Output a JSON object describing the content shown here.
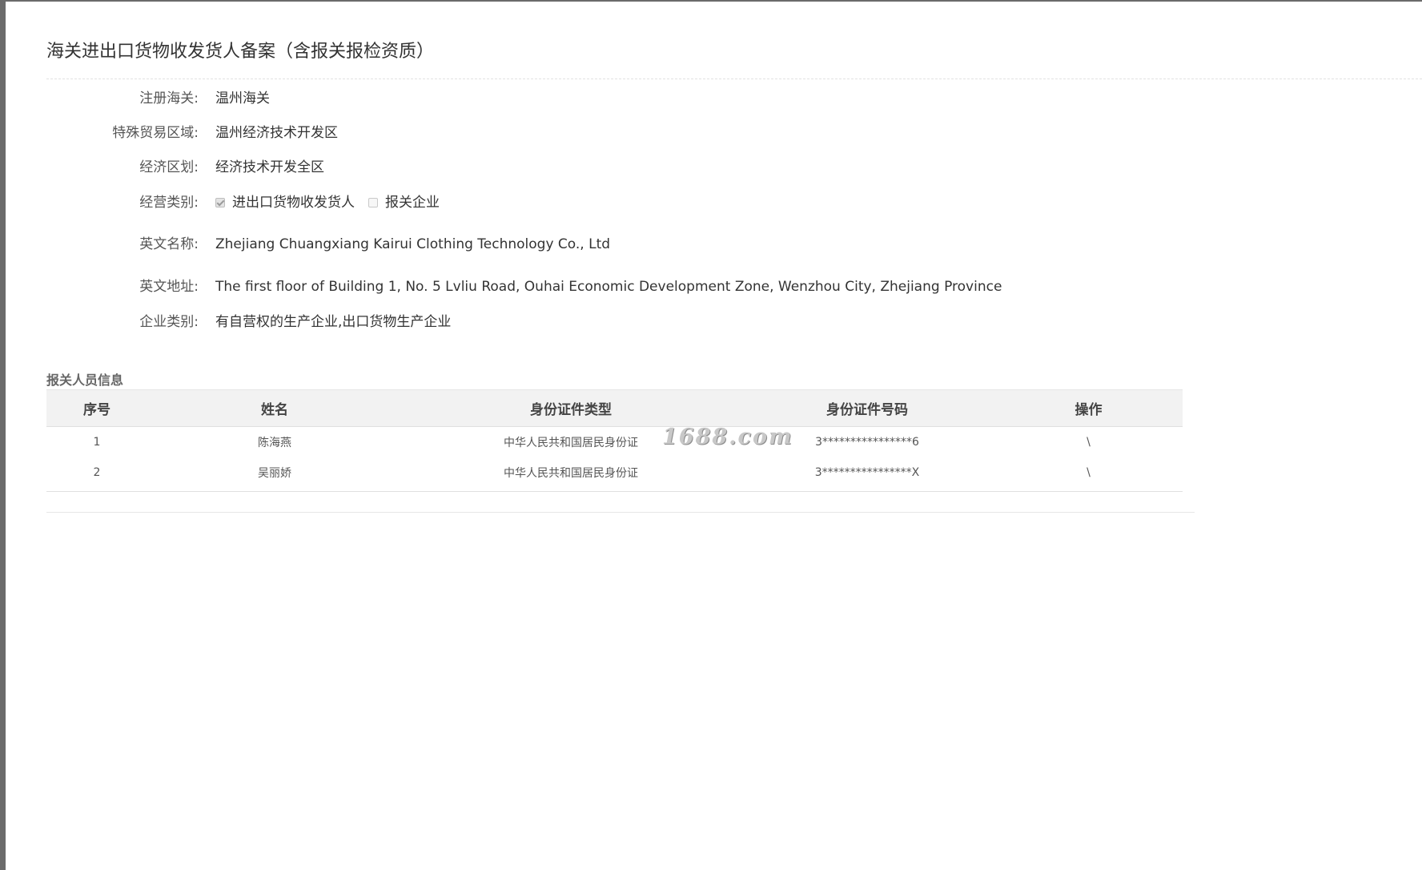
{
  "page": {
    "title": "海关进出口货物收发货人备案（含报关报检资质）"
  },
  "info": {
    "customs": {
      "label": "注册海关:",
      "value": "温州海关"
    },
    "trade_zone": {
      "label": "特殊贸易区域:",
      "value": "温州经济技术开发区"
    },
    "economic_zone": {
      "label": "经济区划:",
      "value": "经济技术开发全区"
    },
    "business_type": {
      "label": "经营类别:",
      "options": [
        {
          "label": "进出口货物收发货人",
          "checked": true
        },
        {
          "label": "报关企业",
          "checked": false
        }
      ]
    },
    "english_name": {
      "label": "英文名称:",
      "value": "Zhejiang Chuangxiang Kairui Clothing Technology Co., Ltd"
    },
    "english_address": {
      "label": "英文地址:",
      "value": "The first floor of Building 1, No. 5 Lvliu Road, Ouhai Economic Development Zone, Wenzhou City, Zhejiang Province"
    },
    "enterprise_type": {
      "label": "企业类别:",
      "value": "有自营权的生产企业,出口货物生产企业"
    }
  },
  "personnel": {
    "section_title": "报关人员信息",
    "columns": [
      "序号",
      "姓名",
      "身份证件类型",
      "身份证件号码",
      "操作"
    ],
    "rows": [
      {
        "index": "1",
        "name": "陈海燕",
        "id_type": "中华人民共和国居民身份证",
        "id_number": "3****************6",
        "action": "\\"
      },
      {
        "index": "2",
        "name": "吴丽娇",
        "id_type": "中华人民共和国居民身份证",
        "id_number": "3****************X",
        "action": "\\"
      }
    ]
  },
  "watermark": {
    "text": "1688.com"
  }
}
